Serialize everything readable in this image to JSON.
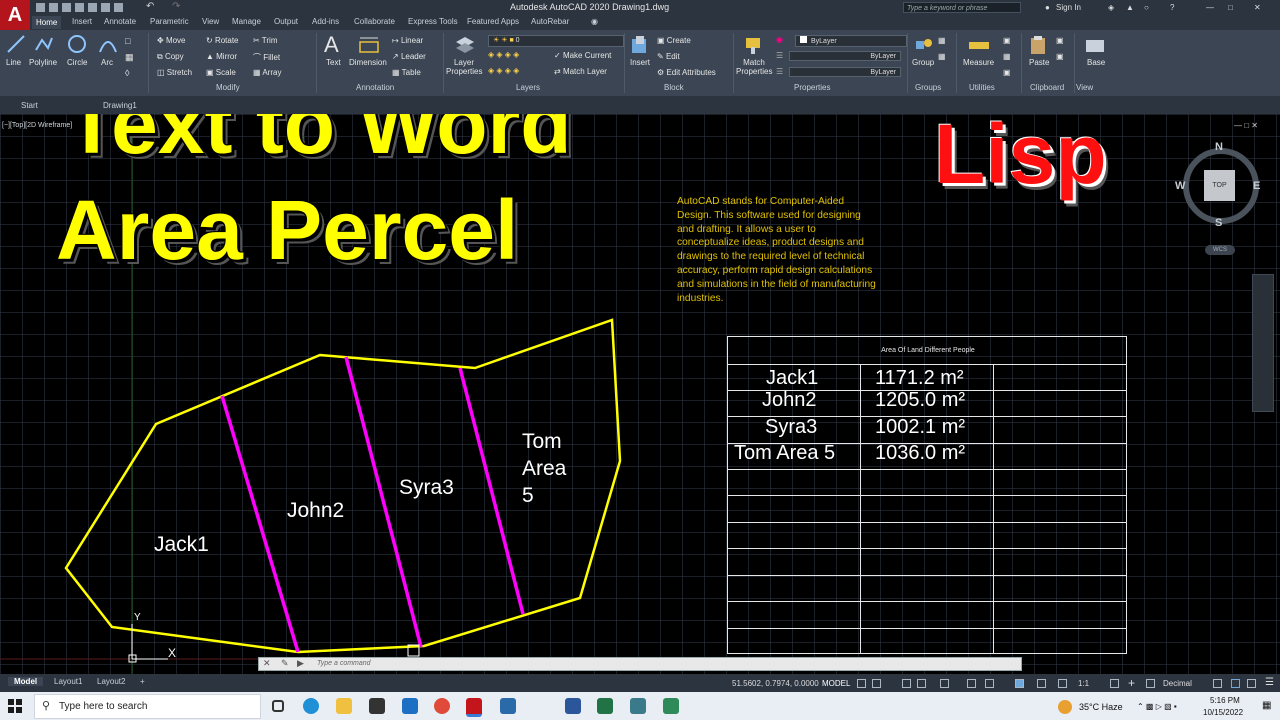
{
  "window": {
    "title": "Autodesk AutoCAD 2020    Drawing1.dwg",
    "app_letter": "A",
    "search_placeholder": "Type a keyword or phrase",
    "sign_in": "Sign In"
  },
  "tabs": [
    "Home",
    "Insert",
    "Annotate",
    "Parametric",
    "View",
    "Manage",
    "Output",
    "Add-ins",
    "Collaborate",
    "Express Tools",
    "Featured Apps",
    "AutoRebar"
  ],
  "ribbon": {
    "draw": {
      "line": "Line",
      "polyline": "Polyline",
      "circle": "Circle",
      "arc": "Arc"
    },
    "modify": {
      "move": "Move",
      "rotate": "Rotate",
      "trim": "Trim",
      "copy": "Copy",
      "mirror": "Mirror",
      "fillet": "Fillet",
      "stretch": "Stretch",
      "scale": "Scale",
      "array": "Array",
      "panel": "Modify"
    },
    "annotation": {
      "text": "Text",
      "dimension": "Dimension",
      "linear": "Linear",
      "leader": "Leader",
      "table": "Table",
      "panel": "Annotation"
    },
    "layers": {
      "layer_properties": "Layer Properties",
      "current_layer": "0",
      "make_current": "Make Current",
      "match_layer": "Match Layer",
      "panel": "Layers"
    },
    "block": {
      "insert": "Insert",
      "create": "Create",
      "edit": "Edit",
      "edit_attributes": "Edit Attributes",
      "panel": "Block"
    },
    "properties": {
      "match_properties": "Match Properties",
      "color": "ByLayer",
      "linetype": "ByLayer",
      "lineweight": "ByLayer",
      "panel": "Properties"
    },
    "groups": {
      "group": "Group",
      "panel": "Groups"
    },
    "utilities": {
      "measure": "Measure",
      "panel": "Utilities"
    },
    "clipboard": {
      "paste": "Paste",
      "panel": "Clipboard"
    },
    "view": {
      "base": "Base",
      "panel": "View"
    }
  },
  "file_tabs": {
    "start": "Start",
    "drawing": "Drawing1"
  },
  "canvas": {
    "viewport_label": "[−][Top][2D Wireframe]",
    "overlay_title_line1": "Text to Word",
    "overlay_title_line2": "Area Percel",
    "overlay_lisp": "Lisp",
    "paragraph": "AutoCAD stands for Computer-Aided Design. This software used for designing and drafting. It allows a user to conceptualize ideas, product designs and drawings to the required level of technical accuracy, perform rapid design calculations and simulations in the field of manufacturing industries.",
    "parcels": {
      "jack": "Jack1",
      "john": "John2",
      "syra": "Syra3",
      "tom_line1": "Tom",
      "tom_line2": "Area",
      "tom_line3": "5"
    },
    "ucs": {
      "y": "Y",
      "x": "X"
    },
    "colors": {
      "boundary": "#ffff00",
      "dividers": "#ff00ff",
      "title": "#ffff00",
      "lisp": "#ff1010",
      "paragraph": "#e0c100"
    }
  },
  "table": {
    "title": "Area Of Land Different People",
    "rows": [
      {
        "name": "Jack1",
        "area": "1171.2 m²"
      },
      {
        "name": "John2",
        "area": "1205.0 m²"
      },
      {
        "name": "Syra3",
        "area": "1002.1 m²"
      },
      {
        "name": "Tom Area 5",
        "area": "1036.0 m²"
      }
    ]
  },
  "viewcube": {
    "n": "N",
    "s": "S",
    "e": "E",
    "w": "W",
    "top": "TOP",
    "wcs": "WCS"
  },
  "command_line": {
    "placeholder": "Type a command"
  },
  "layout_tabs": [
    "Model",
    "Layout1",
    "Layout2"
  ],
  "status": {
    "coords": "51.5602, 0.7974, 0.0000",
    "model": "MODEL",
    "scale": "1:1",
    "units": "Decimal"
  },
  "taskbar": {
    "search": "Type here to search",
    "weather": "35°C  Haze",
    "time": "5:16 PM",
    "date": "10/15/2022"
  }
}
